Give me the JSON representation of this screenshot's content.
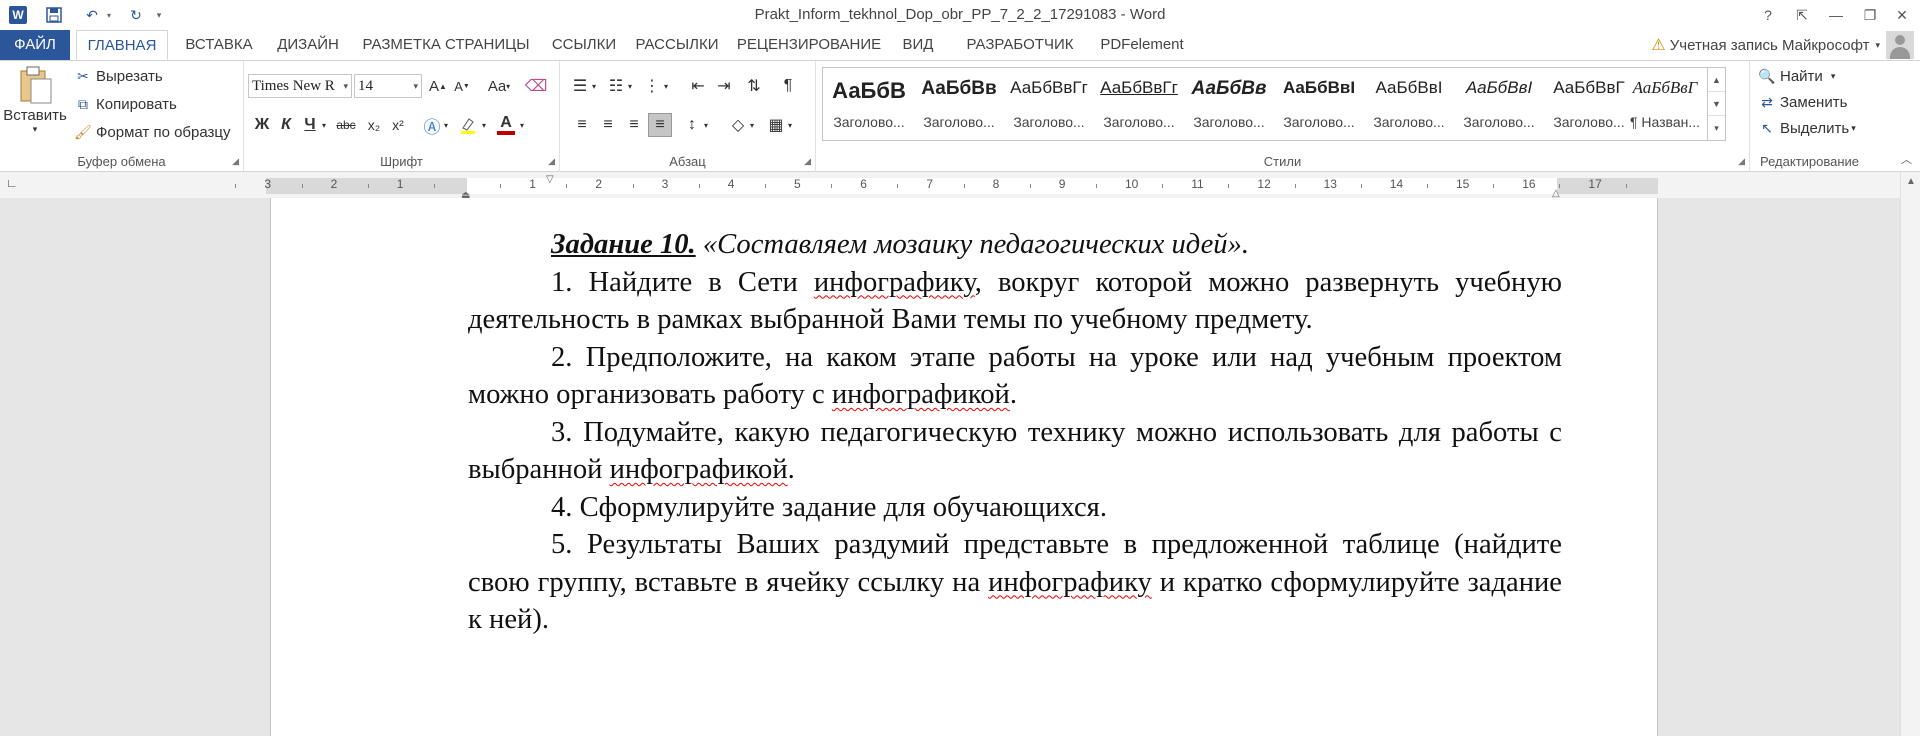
{
  "titlebar": {
    "title": "Prakt_Inform_tekhnol_Dop_obr_PP_7_2_2_17291083 - Word",
    "help": "?",
    "ribbon_display": "⇱",
    "minimize": "—",
    "restore": "❐",
    "close": "✕"
  },
  "tabs": {
    "file": "ФАЙЛ",
    "home": "ГЛАВНАЯ",
    "insert": "ВСТАВКА",
    "design": "ДИЗАЙН",
    "layout": "РАЗМЕТКА СТРАНИЦЫ",
    "references": "ССЫЛКИ",
    "mailings": "РАССЫЛКИ",
    "review": "РЕЦЕНЗИРОВАНИЕ",
    "view": "ВИД",
    "developer": "РАЗРАБОТЧИК",
    "pdfelement": "PDFelement"
  },
  "account": {
    "label": "Учетная запись Майкрософт"
  },
  "clipboard": {
    "paste": "Вставить",
    "cut": "Вырезать",
    "copy": "Копировать",
    "format_painter": "Формат по образцу",
    "label": "Буфер обмена"
  },
  "font": {
    "family": "Times New R",
    "size": "14",
    "label": "Шрифт",
    "grow": "A",
    "shrink": "A",
    "case": "Aa",
    "bold": "Ж",
    "italic": "К",
    "underline": "Ч",
    "strike": "abc",
    "subscript": "x₂",
    "superscript": "x²",
    "font_color": "A"
  },
  "paragraph": {
    "label": "Абзац",
    "pilcrow": "¶"
  },
  "styles": {
    "label": "Стили",
    "items": [
      {
        "sample": "АаБбВ",
        "name": "Заголово..."
      },
      {
        "sample": "АаБбВв",
        "name": "Заголово..."
      },
      {
        "sample": "АаБбВвГг",
        "name": "Заголово..."
      },
      {
        "sample": "АаБбВвГг",
        "name": "Заголово..."
      },
      {
        "sample": "АаБбВв",
        "name": "Заголово..."
      },
      {
        "sample": "АаБбВвI",
        "name": "Заголово..."
      },
      {
        "sample": "АаБбВвI",
        "name": "Заголово..."
      },
      {
        "sample": "АаБбВвI",
        "name": "Заголово..."
      },
      {
        "sample": "АаБбВвГ",
        "name": "Заголово..."
      },
      {
        "sample": "АаБбВвГ",
        "name": "¶ Назван..."
      }
    ]
  },
  "editing": {
    "label": "Редактирование",
    "find": "Найти",
    "replace": "Заменить",
    "select": "Выделить"
  },
  "ruler": {
    "numbers": [
      "3",
      "2",
      "1",
      "1",
      "2",
      "3",
      "4",
      "5",
      "6",
      "7",
      "8",
      "9",
      "10",
      "11",
      "12",
      "13",
      "14",
      "15",
      "16",
      "17"
    ]
  },
  "document": {
    "title_bold": "Задание 10.",
    "title_rest": " «Составляем мозаику педагогических идей».",
    "p1_a": "1. Найдите в Сети ",
    "p1_link": "инфографику",
    "p1_b": ", вокруг которой можно развернуть учебную деятельность в рамках выбранной Вами темы по учебному предмету.",
    "p2_a": "2. Предположите, на каком этапе работы на уроке или над учебным проектом можно организовать работу с ",
    "p2_link": "инфографикой",
    "p2_b": ".",
    "p3_a": "3. Подумайте, какую педагогическую технику можно использовать для работы с выбранной ",
    "p3_link": "инфографикой",
    "p3_b": ".",
    "p4": "4. Сформулируйте задание для обучающихся.",
    "p5_a": "5. Результаты Ваших раздумий представьте в предложенной таблице (найдите свою группу, вставьте в ячейку ссылку на ",
    "p5_link": "инфографику",
    "p5_b": " и кратко сформулируйте задание к ней)."
  },
  "colors": {
    "accent": "#2b579a",
    "spell_error": "#e00000"
  }
}
